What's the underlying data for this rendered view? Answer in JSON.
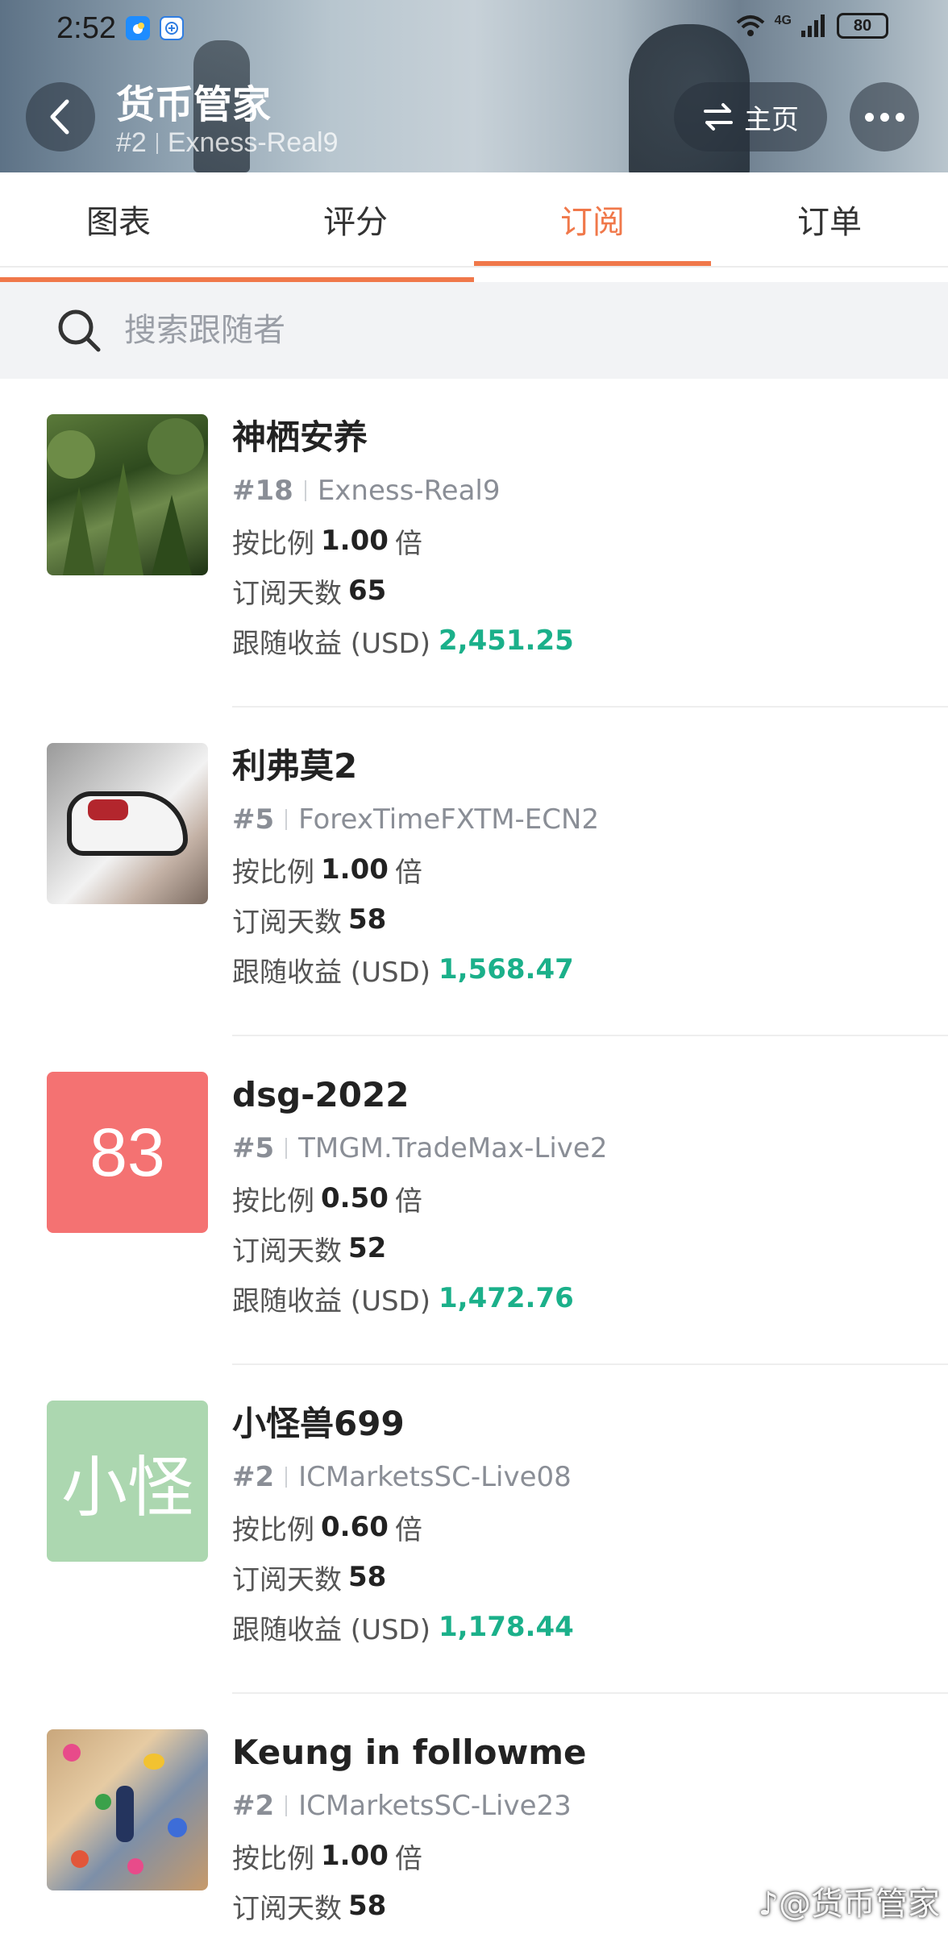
{
  "status_bar": {
    "time": "2:52",
    "network": "4G",
    "battery": "80"
  },
  "header": {
    "title": "货币管家",
    "rank": "#2",
    "server": "Exness-Real9",
    "home_label": "主页"
  },
  "tabs": [
    {
      "label": "图表",
      "active": false
    },
    {
      "label": "评分",
      "active": false
    },
    {
      "label": "订阅",
      "active": true
    },
    {
      "label": "订单",
      "active": false
    }
  ],
  "search": {
    "placeholder": "搜索跟随者"
  },
  "labels": {
    "ratio_prefix": "按比例",
    "ratio_suffix": "倍",
    "days_prefix": "订阅天数",
    "profit_prefix": "跟随收益 (USD)"
  },
  "followers": [
    {
      "name": "神栖安养",
      "rank": "#18",
      "server": "Exness-Real9",
      "ratio": "1.00",
      "days": "65",
      "profit": "2,451.25",
      "avatar": "forest-photo"
    },
    {
      "name": "利弗莫2",
      "rank": "#5",
      "server": "ForexTimeFXTM-ECN2",
      "ratio": "1.00",
      "days": "58",
      "profit": "1,568.47",
      "avatar": "sneaker-photo"
    },
    {
      "name": "dsg-2022",
      "rank": "#5",
      "server": "TMGM.TradeMax-Live2",
      "ratio": "0.50",
      "days": "52",
      "profit": "1,472.76",
      "avatar_text": "83",
      "avatar_color": "#f47272"
    },
    {
      "name": "小怪兽699",
      "rank": "#2",
      "server": "ICMarketsSC-Live08",
      "ratio": "0.60",
      "days": "58",
      "profit": "1,178.44",
      "avatar_text": "小怪",
      "avatar_color": "#acd7b0"
    },
    {
      "name": "Keung in followme",
      "rank": "#2",
      "server": "ICMarketsSC-Live23",
      "ratio": "1.00",
      "days": "58",
      "profit": "",
      "avatar": "climbing-wall-photo"
    }
  ],
  "watermark": "@货币管家",
  "colors": {
    "accent": "#f0784a",
    "profit": "#1bb08a"
  }
}
